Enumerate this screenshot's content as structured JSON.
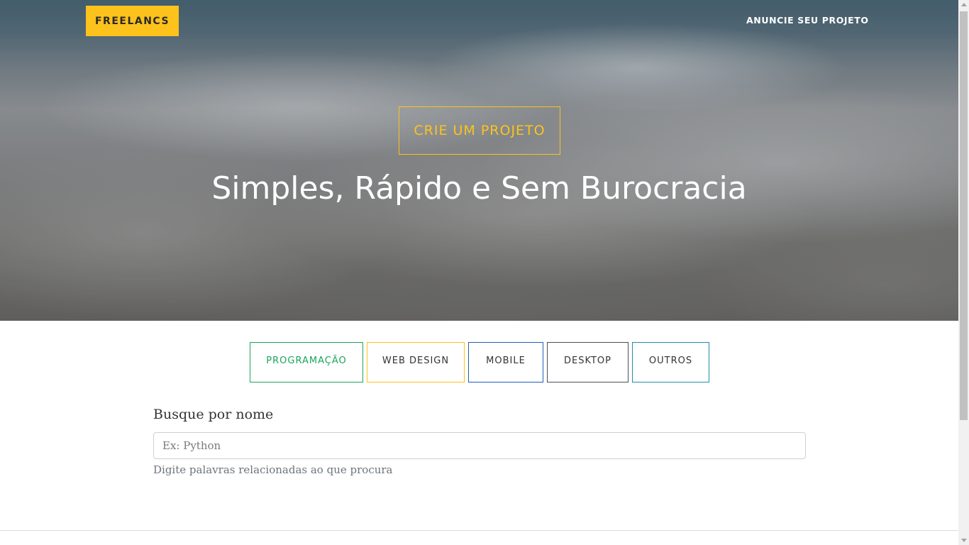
{
  "nav": {
    "brand": "FREELANCS",
    "link": "ANUNCIE SEU PROJETO"
  },
  "hero": {
    "cta": "CRIE UM PROJETO",
    "heading": "Simples, Rápido e Sem Burocracia"
  },
  "categories": [
    {
      "label": "PROGRAMAÇÃO",
      "color": "#1aa55a"
    },
    {
      "label": "WEB DESIGN",
      "color": "#fdc21c"
    },
    {
      "label": "MOBILE",
      "color": "#1f5fb5"
    },
    {
      "label": "DESKTOP",
      "color": "#4a5056"
    },
    {
      "label": "OUTROS",
      "color": "#1f8fa6"
    }
  ],
  "search": {
    "label": "Busque por nome",
    "placeholder": "Ex: Python",
    "value": "",
    "help": "Digite palavras relacionadas ao que procura"
  },
  "theme": {
    "accent": "#fdc21c"
  }
}
